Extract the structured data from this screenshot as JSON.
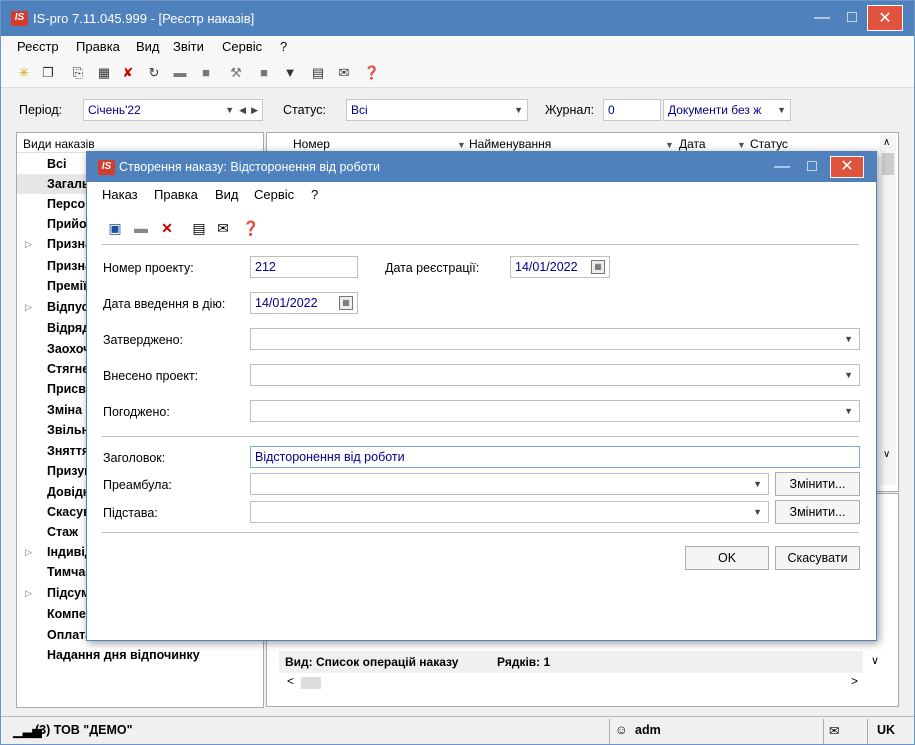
{
  "app": {
    "title": "IS-pro 7.11.045.999 - [Реєстр наказів]",
    "logo_text": "IS",
    "accent_color": "#4f81bd",
    "close_color": "#e0533d"
  },
  "menu": [
    "Реєстр",
    "Правка",
    "Вид",
    "Звіти",
    "Сервіс",
    "?"
  ],
  "toolbar_icons": [
    "new-icon",
    "copy-icon",
    "new-doc-icon",
    "table-icon",
    "delete-icon",
    "refresh-icon",
    "print-icon",
    "export-icon",
    "key-icon",
    "stop-icon",
    "filter-icon",
    "document-icon",
    "mail-icon",
    "help-icon"
  ],
  "filters": {
    "period_label": "Період:",
    "period_value": "Січень'22",
    "status_label": "Статус:",
    "status_value": "Всі",
    "journal_label": "Журнал:",
    "journal_value": "0",
    "journal_name": "Документи без ж"
  },
  "left_panel": {
    "header": "Види наказів",
    "items": [
      {
        "label": "Всі",
        "expandable": false
      },
      {
        "label": "Загальні",
        "expandable": false
      },
      {
        "label": "Персонал",
        "expandable": false
      },
      {
        "label": "Прийом",
        "expandable": false
      },
      {
        "label": "Призначення",
        "expandable": true
      },
      {
        "label": "Призначення",
        "expandable": false
      },
      {
        "label": "Премії",
        "expandable": false
      },
      {
        "label": "Відпустки",
        "expandable": true
      },
      {
        "label": "Відрядження",
        "expandable": false
      },
      {
        "label": "Заохочення",
        "expandable": false
      },
      {
        "label": "Стягнення",
        "expandable": false
      },
      {
        "label": "Присвоєння",
        "expandable": false
      },
      {
        "label": "Зміна",
        "expandable": false
      },
      {
        "label": "Звільнення",
        "expandable": false
      },
      {
        "label": "Зняття",
        "expandable": false
      },
      {
        "label": "Призупинення",
        "expandable": false
      },
      {
        "label": "Довідки",
        "expandable": false
      },
      {
        "label": "Скасування",
        "expandable": false
      },
      {
        "label": "Стаж",
        "expandable": false
      },
      {
        "label": "Індивідуальні",
        "expandable": true
      },
      {
        "label": "Тимчасові",
        "expandable": false
      },
      {
        "label": "Підсумки",
        "expandable": true
      },
      {
        "label": "Компенсації",
        "expandable": false
      },
      {
        "label": "Оплата",
        "expandable": false
      },
      {
        "label": "Надання дня відпочинку",
        "expandable": false
      }
    ]
  },
  "grid": {
    "columns": [
      "Номер",
      "Найменування",
      "Дата",
      "Статус"
    ]
  },
  "bottom_panel": {
    "view_text": "Вид: Список операцій наказу",
    "rows_text": "Рядків: 1"
  },
  "statusbar": {
    "company": "(3) ТОВ \"ДЕМО\"",
    "user": "adm",
    "lang": "UK"
  },
  "dialog": {
    "title": "Створення наказу: Відсторонення від роботи",
    "menu": [
      "Наказ",
      "Правка",
      "Вид",
      "Сервіс",
      "?"
    ],
    "toolbar_icons": [
      "save-icon",
      "print-icon",
      "delete-icon",
      "document-icon",
      "mail-icon",
      "help-icon"
    ],
    "fields": {
      "project_number_label": "Номер проекту:",
      "project_number_value": "212",
      "reg_date_label": "Дата реєстрації:",
      "reg_date_value": "14/01/2022",
      "effective_date_label": "Дата введення в дію:",
      "effective_date_value": "14/01/2022",
      "approved_label": "Затверджено:",
      "approved_value": "",
      "submitted_label": "Внесено проект:",
      "submitted_value": "",
      "agreed_label": "Погоджено:",
      "agreed_value": "",
      "heading_label": "Заголовок:",
      "heading_value": "Відсторонення від роботи",
      "preamble_label": "Преамбула:",
      "preamble_value": "",
      "basis_label": "Підстава:",
      "basis_value": ""
    },
    "change_button": "Змінити...",
    "ok_button": "OK",
    "cancel_button": "Скасувати"
  }
}
